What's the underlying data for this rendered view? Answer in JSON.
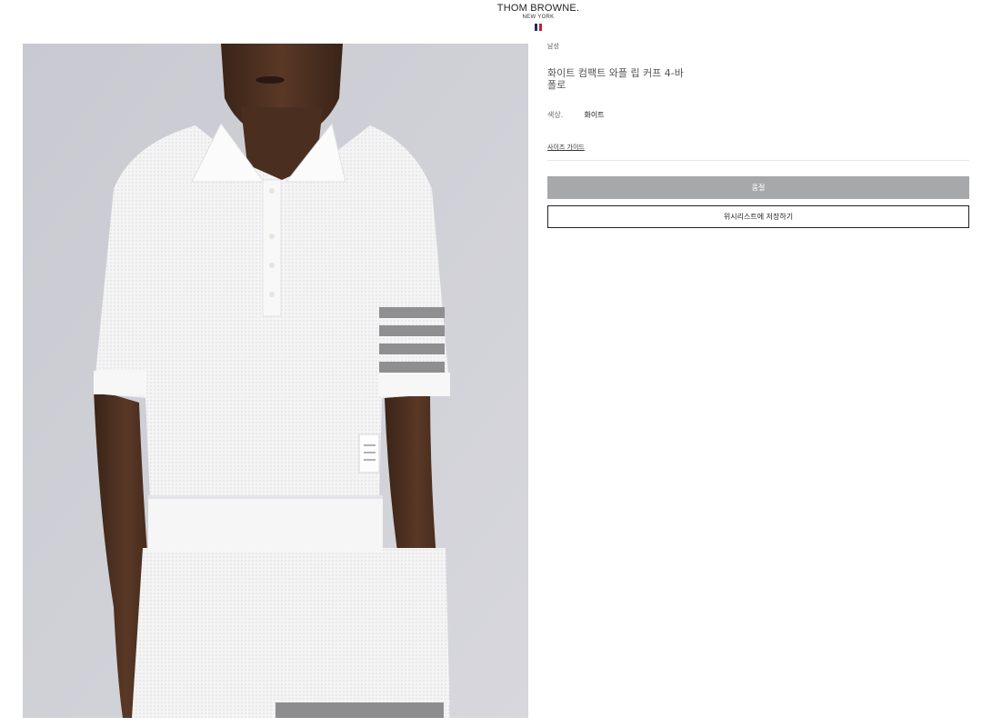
{
  "brand": {
    "name": "THOM BROWNE.",
    "city": "NEW YORK",
    "flag_colors": [
      "#1f2d6a",
      "#ffffff",
      "#c81d2c"
    ]
  },
  "product": {
    "gender": "남성",
    "title": "화이트 컴팩트 와플 립 커프 4-바 폴로",
    "color_label": "색상.",
    "color_value": "화이트",
    "size_guide": "사이즈 가이드",
    "soldout_label": "품절",
    "wishlist_label": "위시리스트에 저장하기",
    "image_alt": "white-polo-product-photo"
  },
  "colors": {
    "soldout_bg": "#a7a8aa",
    "image_bg": "#cfcfd6"
  }
}
